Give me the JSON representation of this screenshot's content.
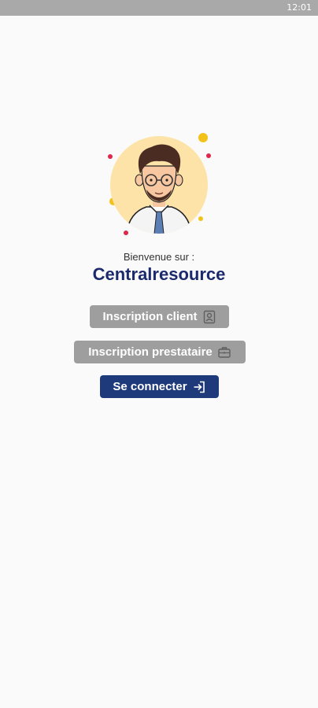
{
  "status_bar": {
    "time": "12:01"
  },
  "welcome": {
    "greeting": "Bienvenue sur :",
    "app_name": "Centralresource"
  },
  "buttons": {
    "client_signup": "Inscription client",
    "provider_signup": "Inscription prestataire",
    "login": "Se connecter"
  },
  "icons": {
    "client_signup": "id-badge-icon",
    "provider_signup": "briefcase-icon",
    "login": "login-arrow-icon"
  },
  "colors": {
    "brand_title": "#1a2a6c",
    "primary_button": "#1e3a7b",
    "secondary_button": "#9e9e9e",
    "status_bar": "#a9a9a9"
  }
}
